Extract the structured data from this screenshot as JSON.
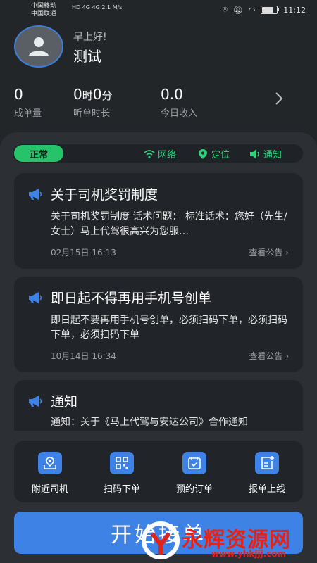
{
  "status_bar": {
    "carrier1": "中国移动",
    "carrier2": "中国联通",
    "net_info": "HD 4G 4G 2.1 M/s",
    "time": "11:12"
  },
  "profile": {
    "greeting": "早上好!",
    "name": "测试"
  },
  "stats": {
    "orders_value": "0",
    "orders_label": "成单量",
    "hours_value": "0",
    "hours_unit": "时",
    "minutes_value": "0",
    "minutes_unit": "分",
    "duration_label": "听单时长",
    "income_value": "0.0",
    "income_label": "今日收入"
  },
  "indicators": {
    "state": "正常",
    "network": "网络",
    "location": "定位",
    "notify": "通知"
  },
  "notices": [
    {
      "title": "关于司机奖罚制度",
      "body": "关于司机奖罚制度 话术问题： 标准话术：您好（先生/女士）马上代驾很高兴为您服…",
      "date": "02月15日 16:13",
      "link": "查看公告 ›"
    },
    {
      "title": "即日起不得再用手机号创单",
      "body": "即日起不要再用手机号创单，必须扫码下单，必须扫码下单，必须扫码下单",
      "date": "10月14日 16:34",
      "link": "查看公告 ›"
    },
    {
      "title": "通知",
      "body": "通知：关于《马上代驾与安达公司》合作通知"
    }
  ],
  "actions": [
    {
      "label": "附近司机",
      "icon": "map-pin-icon"
    },
    {
      "label": "扫码下单",
      "icon": "qr-code-icon"
    },
    {
      "label": "预约订单",
      "icon": "calendar-check-icon"
    },
    {
      "label": "报单上线",
      "icon": "report-add-icon"
    }
  ],
  "start_button": "开始接单",
  "watermark": {
    "text": "永辉资源网",
    "url": "www.yhkjjj.com"
  },
  "colors": {
    "accent": "#3f82e6",
    "ok_green": "#27c36b",
    "background": "#232629",
    "card": "#212428"
  }
}
